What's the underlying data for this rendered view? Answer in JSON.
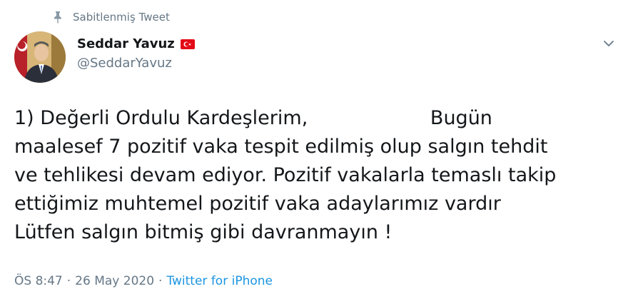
{
  "pinned_label": "Sabitlenmiş Tweet",
  "author": {
    "name": "Seddar Yavuz",
    "handle": "@SeddarYavuz",
    "flag": "turkey-flag"
  },
  "tweet": {
    "lines": [
      "1) Değerli Ordulu Kardeşlerim,                    Bugün",
      "maalesef 7 pozitif vaka tespit edilmiş olup salgın tehdit",
      "ve tehlikesi devam ediyor. Pozitif vakalarla temaslı takip",
      "ettiğimiz muhtemel pozitif vaka adaylarımız vardır",
      "Lütfen salgın bitmiş gibi davranmayın !"
    ]
  },
  "meta": {
    "time": "ÖS 8:47",
    "separator": "·",
    "date": "26 May 2020",
    "source": "Twitter for iPhone"
  },
  "colors": {
    "text": "#14171a",
    "secondary": "#657786",
    "link": "#1b95e0",
    "flag_red": "#e30a17"
  },
  "icons": {
    "pin": "pin-icon",
    "caret": "chevron-down-icon"
  }
}
